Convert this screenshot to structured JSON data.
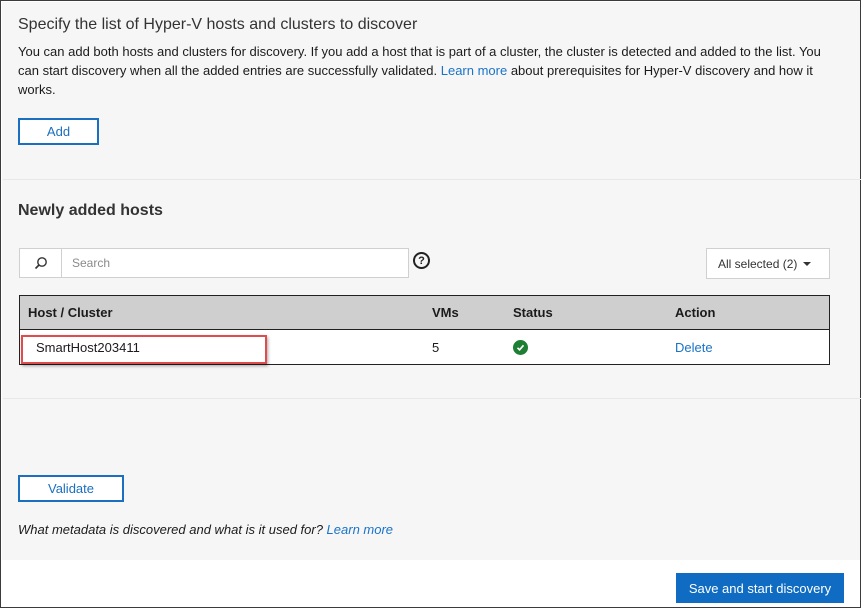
{
  "section": {
    "title": "Specify the list of Hyper-V hosts and clusters to discover",
    "description_part1": "You can add both hosts and clusters for discovery. If you add a host that is part of a cluster, the cluster is detected and added to the list. You can start discovery when all the added entries are successfully validated. ",
    "learn_more_link": "Learn more",
    "description_part2": " about prerequisites for Hyper-V discovery and how it works.",
    "add_label": "Add"
  },
  "hosts": {
    "title": "Newly added hosts",
    "search_placeholder": "Search",
    "help_glyph": "?",
    "filter_label": "All selected (2)",
    "columns": [
      "Host / Cluster",
      "VMs",
      "Status",
      "Action"
    ],
    "rows": [
      {
        "host": "SmartHost203411",
        "vms": "5",
        "status": "success",
        "action": "Delete"
      }
    ]
  },
  "validate_label": "Validate",
  "footnote": {
    "question": "What metadata is discovered and what is it used for? ",
    "link": "Learn more"
  },
  "primary_button_label": "Save and start discovery",
  "icons": {
    "search": "search-icon",
    "help": "help-icon",
    "caret": "chevron-down-icon",
    "status_ok": "check-circle-icon"
  },
  "colors": {
    "accent": "#1a6fc0",
    "primary": "#0f6cc2",
    "success": "#1e7e34",
    "highlight": "#e04b4b"
  }
}
